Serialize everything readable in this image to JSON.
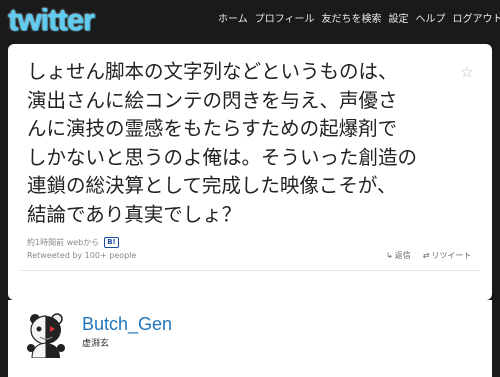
{
  "header": {
    "logo_text": "twitter",
    "nav": [
      "ホーム",
      "プロフィール",
      "友だちを検索",
      "設定",
      "ヘルプ",
      "ログアウト"
    ]
  },
  "tweet": {
    "text": "しょせん脚本の文字列などというものは、\n演出さんに絵コンテの閃きを与え、声優さ\nんに演技の霊感をもたらすための起爆剤で\nしかないと思うのよ俺は。そういった創造の\n連鎖の総決算として完成した映像こそが、\n結論であり真実でしょ？",
    "timestamp": "約1時間前 webから",
    "hatena_badge": "B!",
    "retweet_info": "Retweeted by 100+ people",
    "reply_label": "返信",
    "retweet_label": "リツイート"
  },
  "profile": {
    "screen_name": "Butch_Gen",
    "real_name": "虚淵玄"
  },
  "icons": [
    "star-icon",
    "reply-icon",
    "retweet-icon",
    "bear-avatar"
  ],
  "colors": {
    "logo": "#5ecbef",
    "link": "#2276bb",
    "background": "#1a1a1a"
  }
}
